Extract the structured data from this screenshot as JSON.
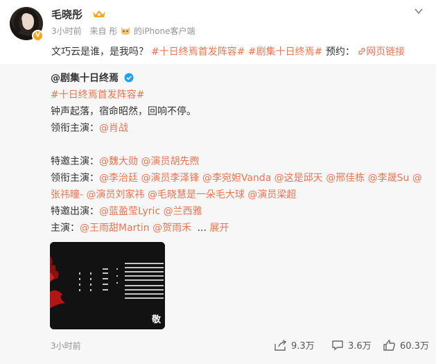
{
  "post": {
    "username": "毛晓彤",
    "time": "3小时前",
    "source_prefix": "来自",
    "source_name_a": "彤",
    "source_name_b": "的iPhone客户端",
    "text_prefix": "文巧云是谁，是我吗？",
    "tag1": "#十日终焉首发阵容#",
    "tag2": "#剧集十日终焉#",
    "text_mid": "预约：",
    "link_label": "网页链接"
  },
  "repost": {
    "author": "@剧集十日终焉",
    "tag": "#十日终焉首发阵容#",
    "line_slogan": "钟声起落，宿命昭然，回响不停。",
    "lead_label": "领衔主演：",
    "lead_1": "@肖战",
    "special_label": "特邀主演：",
    "special_1": "@魏大勋 @演员胡先煦",
    "lead2_label": "领衔主演：",
    "lead2_1": "@李治廷 @演员李泽锋 @李宛妲Vanda @这是邱天 @邢佳栋 @李晟Su @",
    "lead2_2": "张祎曈- @演员刘家祎 @毛晓慧是一朵毛大球 @演员梁超",
    "special_out_label": "特邀出演：",
    "special_out_1": "@蓝盈莹Lyric @兰西雅",
    "main_label": "主演：",
    "main_1": "@王雨甜Martin @贺雨禾",
    "expand_ellipsis": "...",
    "expand_label": "展开",
    "thumb_char": "敬",
    "time": "3小时前",
    "share_count": "9.3万",
    "comment_count": "3.6万",
    "like_count": "60.3万"
  },
  "colors": {
    "accent": "#eb7350",
    "meta_gray": "#939393",
    "repost_bg": "#f7f7f7",
    "verified_blue": "#1da1f2"
  },
  "icons": [
    "vip-crown-icon",
    "source-cat-icon",
    "chevron-down-icon",
    "link-icon",
    "verified-icon",
    "share-icon",
    "comment-icon",
    "like-icon"
  ]
}
